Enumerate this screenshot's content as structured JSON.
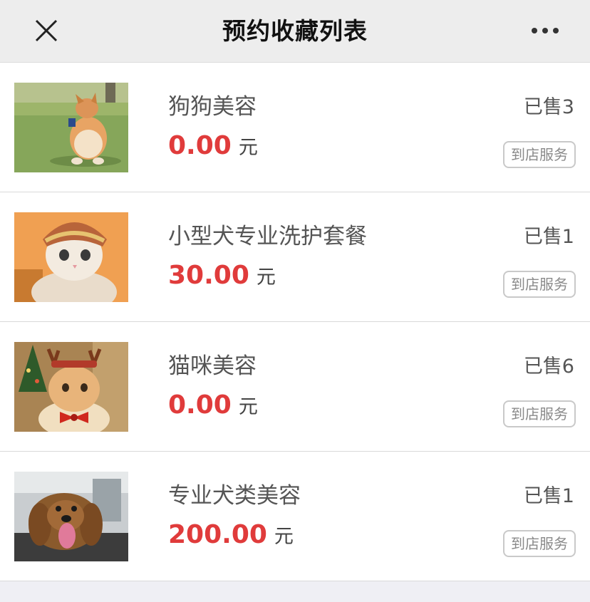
{
  "header": {
    "title": "预约收藏列表",
    "close_icon": "close-icon",
    "more_icon": "more-dots-icon"
  },
  "items": [
    {
      "name": "狗狗美容",
      "price": "0.00",
      "unit": "元",
      "sold": "已售3",
      "badge": "到店服务",
      "thumbnail": "corgi-photo"
    },
    {
      "name": "小型犬专业洗护套餐",
      "price": "30.00",
      "unit": "元",
      "sold": "已售1",
      "badge": "到店服务",
      "thumbnail": "cat-in-hat-photo"
    },
    {
      "name": "猫咪美容",
      "price": "0.00",
      "unit": "元",
      "sold": "已售6",
      "badge": "到店服务",
      "thumbnail": "cat-reindeer-photo"
    },
    {
      "name": "专业犬类美容",
      "price": "200.00",
      "unit": "元",
      "sold": "已售1",
      "badge": "到店服务",
      "thumbnail": "dog-bath-photo"
    }
  ],
  "colors": {
    "price": "#e03b3b",
    "header_bg": "#ededed",
    "page_bg": "#efeff4"
  }
}
